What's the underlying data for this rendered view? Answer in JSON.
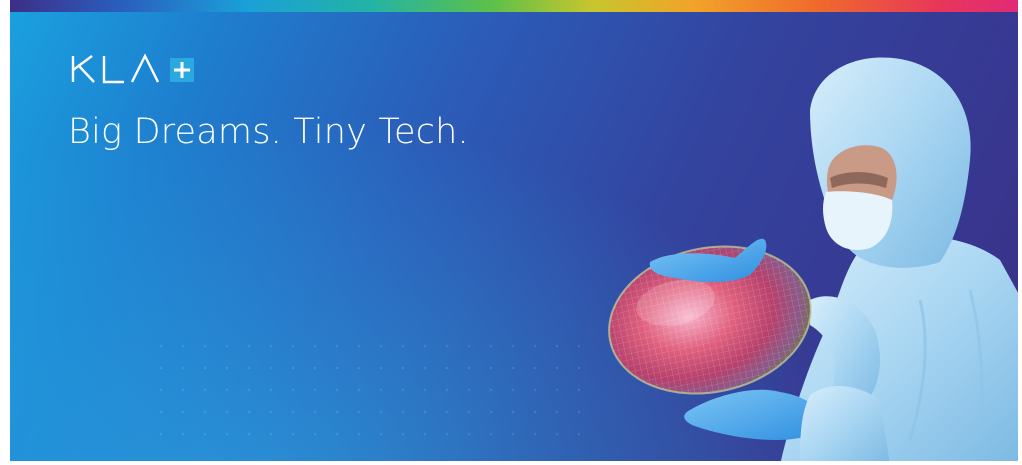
{
  "banner": {
    "logo_text": "KLA",
    "tagline": "Big Dreams. Tiny Tech."
  },
  "colors": {
    "logo_plus_bg": "#29a9e0",
    "text": "#ffffff",
    "suit": "#a9d6f2",
    "glove": "#4aa8ee"
  },
  "icons": {
    "logo_plus": "plus-icon"
  }
}
